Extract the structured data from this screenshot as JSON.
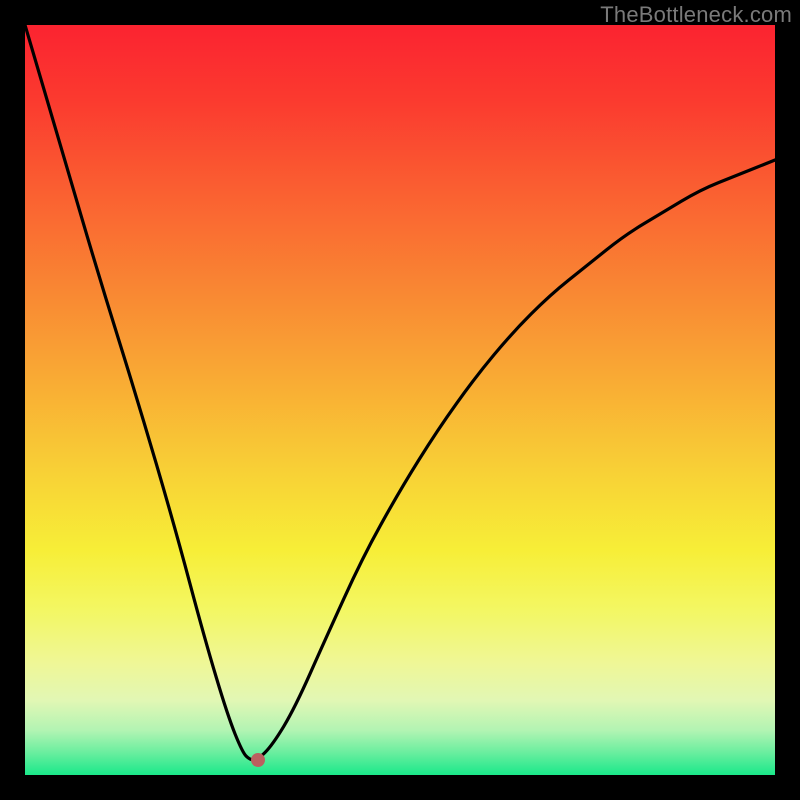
{
  "watermark": "TheBottleneck.com",
  "chart_data": {
    "type": "line",
    "title": "",
    "xlabel": "",
    "ylabel": "",
    "ylim": [
      0,
      100
    ],
    "xlim": [
      0,
      100
    ],
    "series": [
      {
        "name": "bottleneck-curve",
        "x": [
          0,
          5,
          10,
          15,
          20,
          24,
          27,
          29,
          30,
          31,
          33,
          36,
          40,
          45,
          50,
          55,
          60,
          65,
          70,
          75,
          80,
          85,
          90,
          95,
          100
        ],
        "values": [
          100,
          83,
          66,
          50,
          33,
          18,
          8,
          3,
          2,
          2,
          4,
          9,
          18,
          29,
          38,
          46,
          53,
          59,
          64,
          68,
          72,
          75,
          78,
          80,
          82
        ]
      }
    ],
    "marker": {
      "x": 31,
      "y": 2,
      "color": "#bb5f5f"
    },
    "gradient_stops": [
      {
        "offset": 0.0,
        "color": "#fb2330"
      },
      {
        "offset": 0.1,
        "color": "#fb3a2f"
      },
      {
        "offset": 0.22,
        "color": "#fa5f31"
      },
      {
        "offset": 0.35,
        "color": "#f98633"
      },
      {
        "offset": 0.48,
        "color": "#f9ad34"
      },
      {
        "offset": 0.6,
        "color": "#f8d236"
      },
      {
        "offset": 0.7,
        "color": "#f7ee37"
      },
      {
        "offset": 0.78,
        "color": "#f3f763"
      },
      {
        "offset": 0.85,
        "color": "#eff796"
      },
      {
        "offset": 0.9,
        "color": "#e2f7b4"
      },
      {
        "offset": 0.94,
        "color": "#b3f4b3"
      },
      {
        "offset": 0.97,
        "color": "#6aee9f"
      },
      {
        "offset": 1.0,
        "color": "#1ae88a"
      }
    ]
  }
}
